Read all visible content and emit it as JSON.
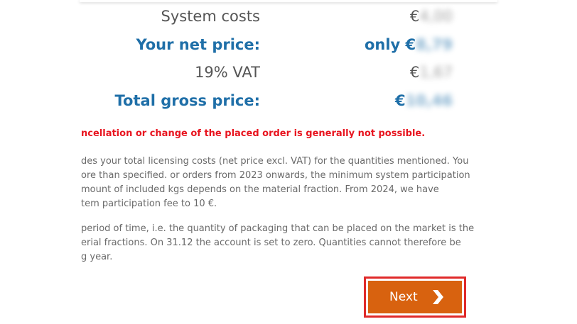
{
  "pricing": {
    "system_costs": {
      "label": "System costs",
      "value": "€",
      "value_hidden": "4,00"
    },
    "net_price": {
      "label": "Your net price:",
      "value": "only €",
      "value_hidden": "8,79"
    },
    "vat": {
      "label": "19% VAT",
      "value": "€",
      "value_hidden": "1,67"
    },
    "gross_price": {
      "label": "Total gross price:",
      "value": "€",
      "value_hidden": "10,46"
    }
  },
  "warning": "ncellation or change of the placed order is generally not possible.",
  "paragraph1": [
    "des your total licensing costs (net price excl. VAT) for the quantities mentioned. You",
    "ore than specified. or orders from 2023 onwards, the minimum system participation",
    "mount of included kgs depends on the material fraction. From 2024, we have",
    "tem participation fee to 10 €."
  ],
  "paragraph2": [
    "period of time, i.e. the quantity of packaging that can be placed on the market is the",
    "erial fractions. On 31.12 the account is set to zero. Quantities cannot therefore be",
    "g year."
  ],
  "next_button": {
    "label": "Next",
    "icon": "chevron-right-icon"
  },
  "colors": {
    "accent_blue": "#1f6fa8",
    "warning_red": "#e8141f",
    "button_orange": "#d8620f",
    "highlight_red": "#e02a2a"
  }
}
